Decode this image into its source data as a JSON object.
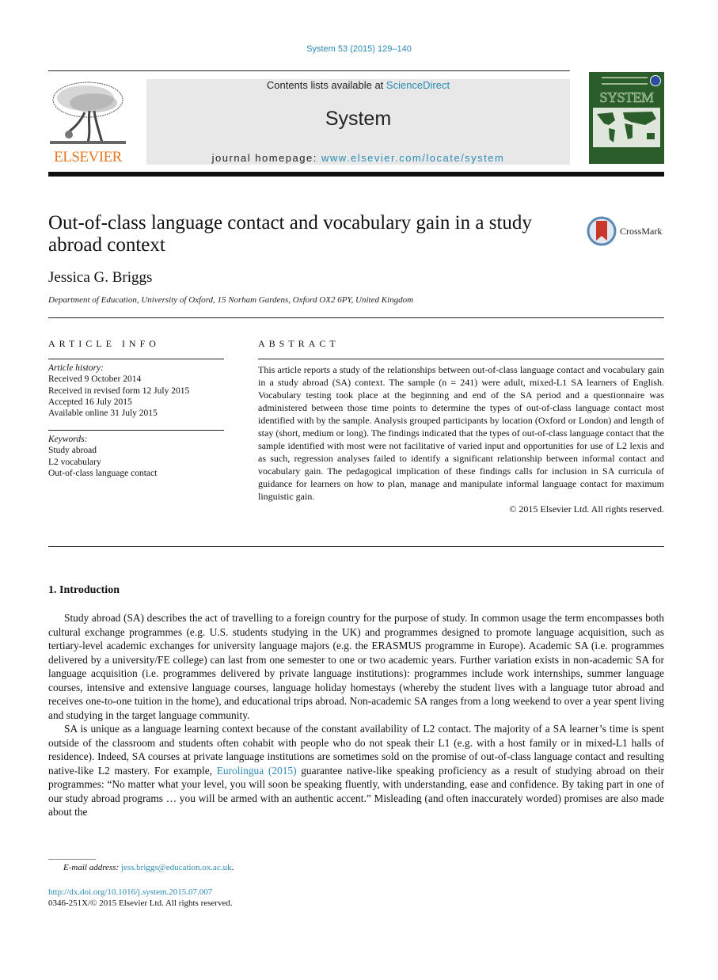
{
  "header": {
    "citation": "System 53 (2015) 129–140",
    "contents_prefix": "Contents lists available at ",
    "contents_link": "ScienceDirect",
    "journal_name": "System",
    "homepage_prefix": "journal homepage: ",
    "homepage_link": "www.elsevier.com/locate/system",
    "publisher": "ELSEVIER",
    "cover_title": "SYSTEM"
  },
  "article": {
    "title": "Out-of-class language contact and vocabulary gain in a study abroad context",
    "crossmark_label": "CrossMark",
    "author": "Jessica G. Briggs",
    "affiliation": "Department of Education, University of Oxford, 15 Norham Gardens, Oxford OX2 6PY, United Kingdom"
  },
  "article_info": {
    "heading": "ARTICLE INFO",
    "history_label": "Article history:",
    "history": [
      "Received 9 October 2014",
      "Received in revised form 12 July 2015",
      "Accepted 16 July 2015",
      "Available online 31 July 2015"
    ],
    "keywords_label": "Keywords:",
    "keywords": [
      "Study abroad",
      "L2 vocabulary",
      "Out-of-class language contact"
    ]
  },
  "abstract": {
    "heading": "ABSTRACT",
    "text": "This article reports a study of the relationships between out-of-class language contact and vocabulary gain in a study abroad (SA) context. The sample (n = 241) were adult, mixed-L1 SA learners of English. Vocabulary testing took place at the beginning and end of the SA period and a questionnaire was administered between those time points to determine the types of out-of-class language contact most identified with by the sample. Analysis grouped participants by location (Oxford or London) and length of stay (short, medium or long). The findings indicated that the types of out-of-class language contact that the sample identified with most were not facilitative of varied input and opportunities for use of L2 lexis and as such, regression analyses failed to identify a significant relationship between informal contact and vocabulary gain. The pedagogical implication of these findings calls for inclusion in SA curricula of guidance for learners on how to plan, manage and manipulate informal language contact for maximum linguistic gain.",
    "copyright": "© 2015 Elsevier Ltd. All rights reserved."
  },
  "body": {
    "section_heading": "1.  Introduction",
    "para1": "Study abroad (SA) describes the act of travelling to a foreign country for the purpose of study. In common usage the term encompasses both cultural exchange programmes (e.g. U.S. students studying in the UK) and programmes designed to promote language acquisition, such as tertiary-level academic exchanges for university language majors (e.g. the ERASMUS programme in Europe). Academic SA (i.e. programmes delivered by a university/FE college) can last from one semester to one or two academic years. Further variation exists in non-academic SA for language acquisition (i.e. programmes delivered by private language institutions): programmes include work internships, summer language courses, intensive and extensive language courses, language holiday homestays (whereby the student lives with a language tutor abroad and receives one-to-one tuition in the home), and educational trips abroad. Non-academic SA ranges from a long weekend to over a year spent living and studying in the target language community.",
    "para2_before": "SA is unique as a language learning context because of the constant availability of L2 contact. The majority of a SA learner’s time is spent outside of the classroom and students often cohabit with people who do not speak their L1 (e.g. with a host family or in mixed-L1 halls of residence). Indeed, SA courses at private language institutions are sometimes sold on the promise of out-of-class language contact and resulting native-like L2 mastery. For example, ",
    "para2_link": "Eurolingua (2015)",
    "para2_after": " guarantee native-like speaking proficiency as a result of studying abroad on their programmes: “No matter what your level, you will soon be speaking fluently, with understanding, ease and confidence. By taking part in one of our study abroad programs … you will be armed with an authentic accent.” Misleading (and often inaccurately worded) promises are also made about the"
  },
  "footer": {
    "email_label": "E-mail address: ",
    "email": "jess.briggs@education.ox.ac.uk",
    "email_suffix": ".",
    "doi": "http://dx.doi.org/10.1016/j.system.2015.07.007",
    "issn": "0346-251X/© 2015 Elsevier Ltd. All rights reserved."
  }
}
